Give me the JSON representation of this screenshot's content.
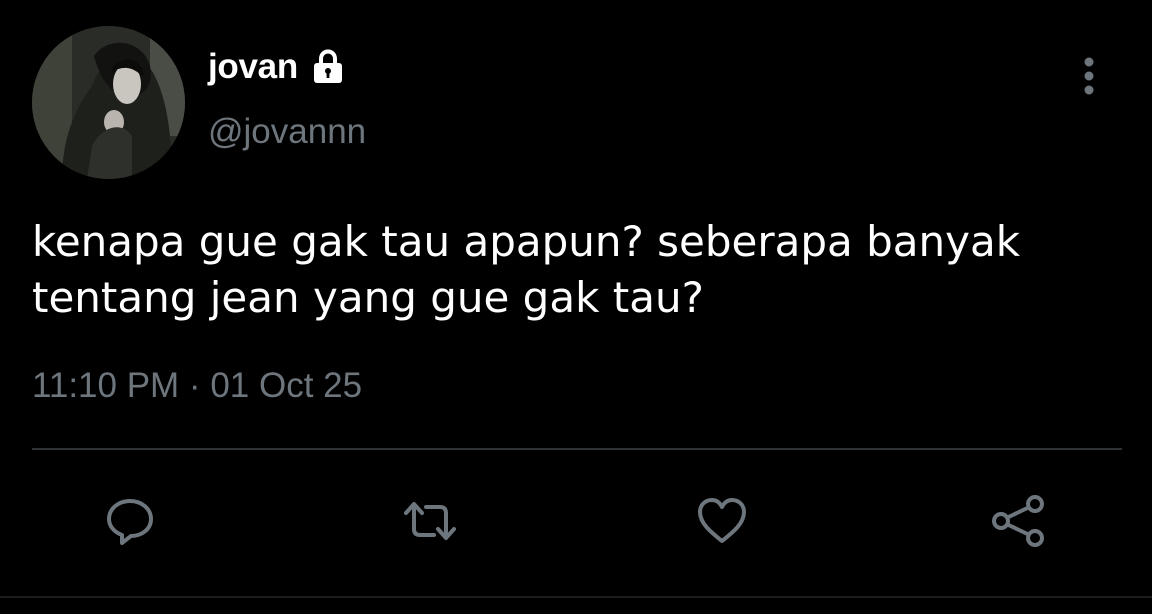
{
  "user": {
    "display_name": "jovan",
    "handle": "@jovannn",
    "protected_icon": "lock-icon",
    "avatar_icon": "profile-photo"
  },
  "tweet": {
    "text": "kenapa gue gak tau apapun? seberapa banyak\ntentang jean yang gue gak tau?",
    "timestamp": "11:10 PM · 01 Oct 25"
  },
  "actions": [
    {
      "name": "reply",
      "icon": "comment-icon"
    },
    {
      "name": "retweet",
      "icon": "retweet-icon"
    },
    {
      "name": "like",
      "icon": "heart-icon"
    },
    {
      "name": "share",
      "icon": "share-icon"
    }
  ],
  "menu": {
    "icon": "more-vertical-icon"
  },
  "colors": {
    "background": "#000000",
    "primary_text": "#ffffff",
    "secondary_text": "#6e767d",
    "divider": "#2f3336",
    "icon": "#6e767d"
  }
}
